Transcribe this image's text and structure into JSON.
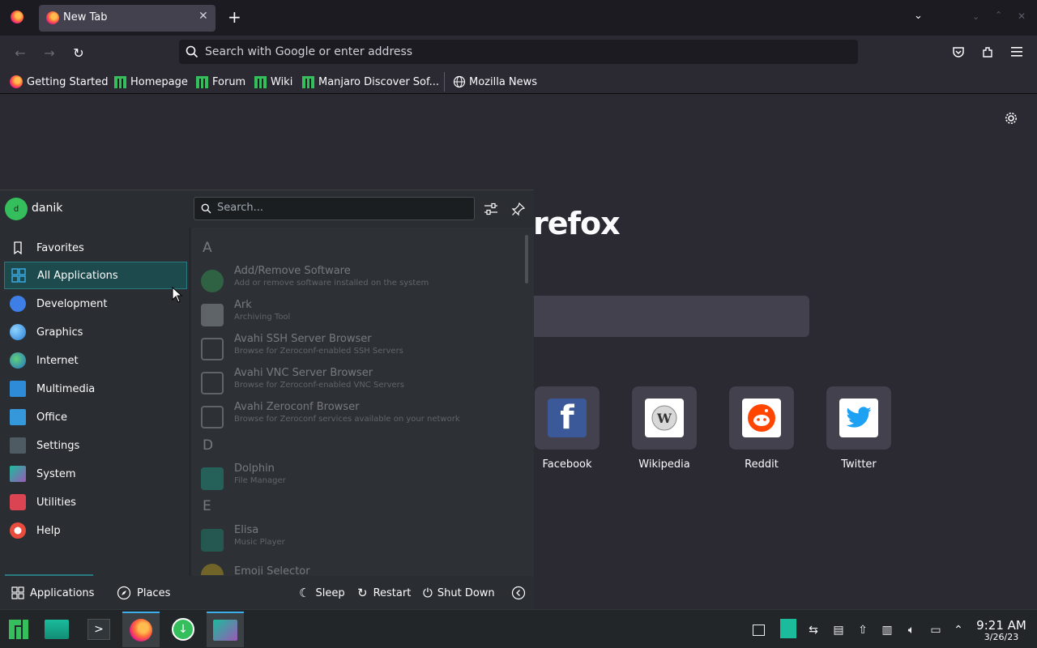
{
  "browser": {
    "tab_title": "New Tab",
    "url_placeholder": "Search with Google or enter address",
    "bookmarks": [
      "Getting Started",
      "Homepage",
      "Forum",
      "Wiki",
      "Manjaro Discover Sof...",
      "Mozilla News"
    ],
    "brand_partial": "refox",
    "top_sites": [
      "Facebook",
      "Wikipedia",
      "Reddit",
      "Twitter"
    ]
  },
  "kmenu": {
    "user": "danik",
    "avatar_letter": "d",
    "search_placeholder": "Search...",
    "categories": [
      "Favorites",
      "All Applications",
      "Development",
      "Graphics",
      "Internet",
      "Multimedia",
      "Office",
      "Settings",
      "System",
      "Utilities",
      "Help"
    ],
    "sections": [
      "A",
      "D",
      "E"
    ],
    "apps": [
      {
        "name": "Add/Remove Software",
        "desc": "Add or remove software installed on the system"
      },
      {
        "name": "Ark",
        "desc": "Archiving Tool"
      },
      {
        "name": "Avahi SSH Server Browser",
        "desc": "Browse for Zeroconf-enabled SSH Servers"
      },
      {
        "name": "Avahi VNC Server Browser",
        "desc": "Browse for Zeroconf-enabled VNC Servers"
      },
      {
        "name": "Avahi Zeroconf Browser",
        "desc": "Browse for Zeroconf services available on your network"
      },
      {
        "name": "Dolphin",
        "desc": "File Manager"
      },
      {
        "name": "Elisa",
        "desc": "Music Player"
      },
      {
        "name": "Emoji Selector",
        "desc": ""
      }
    ],
    "footer": {
      "applications": "Applications",
      "places": "Places",
      "sleep": "Sleep",
      "restart": "Restart",
      "shutdown": "Shut Down"
    }
  },
  "clock": {
    "time": "9:21 AM",
    "date": "3/26/23"
  },
  "colors": {
    "accent": "#3daee9",
    "selected_bg": "#1d4a4d",
    "manjaro_green": "#35bf5c"
  }
}
